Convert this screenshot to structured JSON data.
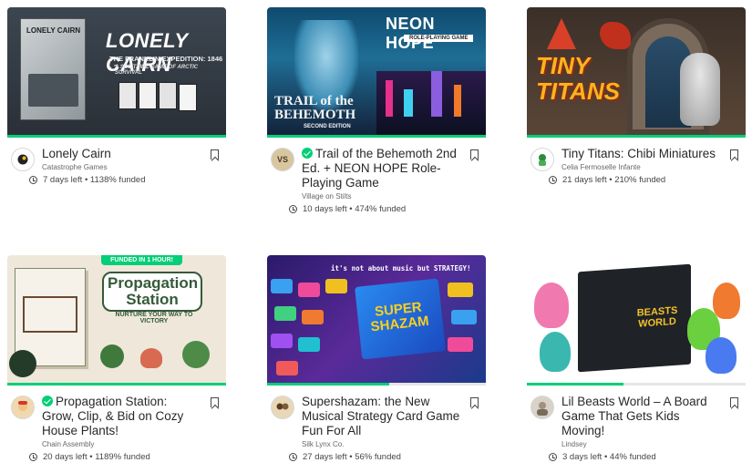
{
  "colors": {
    "accent": "#05ce78",
    "track": "#e6e6e6"
  },
  "projects": [
    {
      "title": "Lonely Cairn",
      "creator": "Catastrophe Games",
      "days_left": "7 days left",
      "funded": "1138% funded",
      "art_title": "LONELY CAIRN",
      "art_subtitle": "THE FRANKLIN EXPEDITION: 1846 - ?",
      "art_tagline": "A SOLITAIRE GAME OF ARCTIC SURVIVAL",
      "progress": 1.0,
      "icon": "bookmark-icon"
    },
    {
      "title": "Trail of the Behemoth 2nd Ed. + NEON HOPE Role-Playing Game",
      "creator": "Village on Stilts",
      "days_left": "10 days left",
      "funded": "474% funded",
      "art_title": "NEON HOPE",
      "art_subtitle": "ROLE-PLAYING GAME",
      "art_logo": "TRAIL of the BEHEMOTH",
      "art_logo_sub": "SECOND EDITION",
      "progress": 1.0,
      "project_we_love": true
    },
    {
      "title": "Tiny Titans: Chibi Miniatures",
      "creator": "Celia Fermoselle Infante",
      "days_left": "21 days left",
      "funded": "210% funded",
      "art_title": "TINY TITANS",
      "progress": 1.0
    },
    {
      "title": "Propagation Station: Grow, Clip, & Bid on Cozy House Plants!",
      "creator": "Chain Assembly",
      "days_left": "20 days left",
      "funded": "1189% funded",
      "art_badge": "FUNDED IN 1 HOUR!",
      "art_title": "Propagation Station",
      "art_tagline": "NURTURE YOUR WAY TO VICTORY",
      "progress": 1.0,
      "project_we_love": true
    },
    {
      "title": "Supershazam: the New Musical Strategy Card Game Fun For All",
      "creator": "Silk Lynx Co.",
      "days_left": "27 days left",
      "funded": "56% funded",
      "art_title": "SUPER SHAZAM",
      "art_tagline": "it's not about music but STRATEGY!",
      "progress": 0.56
    },
    {
      "title": "Lil Beasts World – A Board Game That Gets Kids Moving!",
      "creator": "Lindsey",
      "days_left": "3 days left",
      "funded": "44% funded",
      "art_title": "BEASTS WORLD",
      "progress": 0.44
    }
  ]
}
